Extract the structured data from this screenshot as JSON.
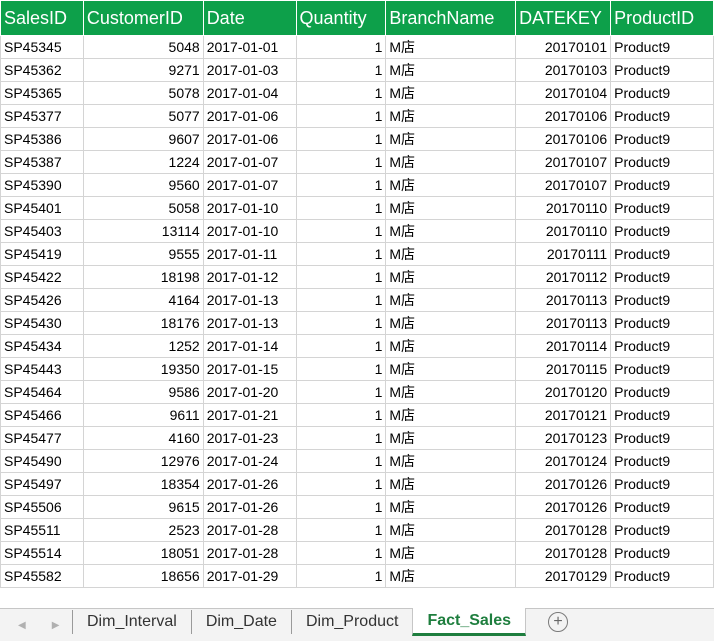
{
  "columns": [
    "SalesID",
    "CustomerID",
    "Date",
    "Quantity",
    "BranchName",
    "DATEKEY",
    "ProductID"
  ],
  "rows": [
    [
      "SP45345",
      "5048",
      "2017-01-01",
      "1",
      "M店",
      "20170101",
      "Product9"
    ],
    [
      "SP45362",
      "9271",
      "2017-01-03",
      "1",
      "M店",
      "20170103",
      "Product9"
    ],
    [
      "SP45365",
      "5078",
      "2017-01-04",
      "1",
      "M店",
      "20170104",
      "Product9"
    ],
    [
      "SP45377",
      "5077",
      "2017-01-06",
      "1",
      "M店",
      "20170106",
      "Product9"
    ],
    [
      "SP45386",
      "9607",
      "2017-01-06",
      "1",
      "M店",
      "20170106",
      "Product9"
    ],
    [
      "SP45387",
      "1224",
      "2017-01-07",
      "1",
      "M店",
      "20170107",
      "Product9"
    ],
    [
      "SP45390",
      "9560",
      "2017-01-07",
      "1",
      "M店",
      "20170107",
      "Product9"
    ],
    [
      "SP45401",
      "5058",
      "2017-01-10",
      "1",
      "M店",
      "20170110",
      "Product9"
    ],
    [
      "SP45403",
      "13114",
      "2017-01-10",
      "1",
      "M店",
      "20170110",
      "Product9"
    ],
    [
      "SP45419",
      "9555",
      "2017-01-11",
      "1",
      "M店",
      "20170111",
      "Product9"
    ],
    [
      "SP45422",
      "18198",
      "2017-01-12",
      "1",
      "M店",
      "20170112",
      "Product9"
    ],
    [
      "SP45426",
      "4164",
      "2017-01-13",
      "1",
      "M店",
      "20170113",
      "Product9"
    ],
    [
      "SP45430",
      "18176",
      "2017-01-13",
      "1",
      "M店",
      "20170113",
      "Product9"
    ],
    [
      "SP45434",
      "1252",
      "2017-01-14",
      "1",
      "M店",
      "20170114",
      "Product9"
    ],
    [
      "SP45443",
      "19350",
      "2017-01-15",
      "1",
      "M店",
      "20170115",
      "Product9"
    ],
    [
      "SP45464",
      "9586",
      "2017-01-20",
      "1",
      "M店",
      "20170120",
      "Product9"
    ],
    [
      "SP45466",
      "9611",
      "2017-01-21",
      "1",
      "M店",
      "20170121",
      "Product9"
    ],
    [
      "SP45477",
      "4160",
      "2017-01-23",
      "1",
      "M店",
      "20170123",
      "Product9"
    ],
    [
      "SP45490",
      "12976",
      "2017-01-24",
      "1",
      "M店",
      "20170124",
      "Product9"
    ],
    [
      "SP45497",
      "18354",
      "2017-01-26",
      "1",
      "M店",
      "20170126",
      "Product9"
    ],
    [
      "SP45506",
      "9615",
      "2017-01-26",
      "1",
      "M店",
      "20170126",
      "Product9"
    ],
    [
      "SP45511",
      "2523",
      "2017-01-28",
      "1",
      "M店",
      "20170128",
      "Product9"
    ],
    [
      "SP45514",
      "18051",
      "2017-01-28",
      "1",
      "M店",
      "20170128",
      "Product9"
    ],
    [
      "SP45582",
      "18656",
      "2017-01-29",
      "1",
      "M店",
      "20170129",
      "Product9"
    ]
  ],
  "tabs": {
    "dim_interval": "Dim_Interval",
    "dim_date": "Dim_Date",
    "dim_product": "Dim_Product",
    "fact_sales": "Fact_Sales"
  },
  "colors": {
    "header_bg": "#0da04a",
    "active_tab": "#1e7e3e"
  }
}
